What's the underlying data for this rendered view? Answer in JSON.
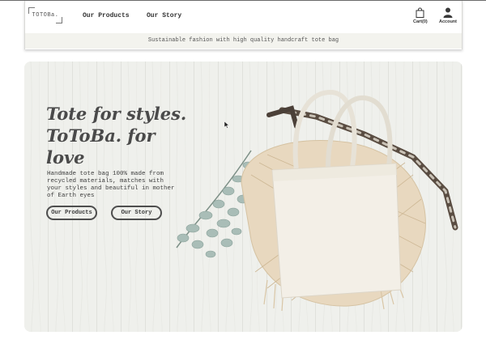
{
  "header": {
    "logo_text": "TOTOBa.",
    "nav": {
      "products": "Our Products",
      "story": "Our Story"
    },
    "cart_label": "Cart(0)",
    "account_label": "Account",
    "tagline": "Sustainable fashion with high quality handcraft tote bag"
  },
  "hero": {
    "headline": "Tote for styles. ToToBa. for love",
    "subtext": "Handmade tote bag 100% made from recycled materials, matches with your styles and beautiful in mother of Earth eyes",
    "buttons": {
      "products": "Our Products",
      "story": "Our Story"
    }
  },
  "icons": {
    "cart": "shopping-bag-icon",
    "account": "user-icon",
    "cursor": "mouse-pointer-icon"
  },
  "colors": {
    "text": "#3a3a3a",
    "tagline_bg": "#f3f3ee",
    "hero_bg": "#eeefeb",
    "button_border": "#4e4e4e"
  }
}
